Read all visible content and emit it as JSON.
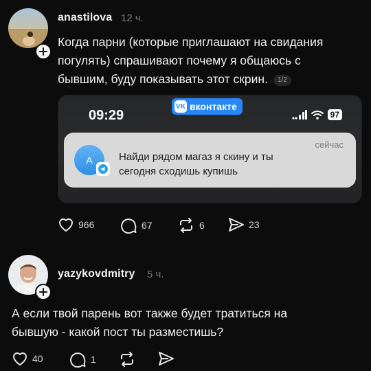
{
  "post1": {
    "username": "anastilova",
    "time": "12 ч.",
    "text_line1": "Когда парни (которые приглашают на свидания",
    "text_line2": "погулять) спрашивают почему я общаюсь с",
    "text_line3": "бывшим, буду показывать этот скрин.",
    "page_indicator": "1/2",
    "screenshot": {
      "clock": "09:29",
      "app_badge": "вконтакте",
      "battery": "97",
      "notification_avatar_letter": "А",
      "notification_time": "сейчас",
      "notification_line1": "Найди рядом магаз я скину и ты",
      "notification_line2": "сегодня сходишь купишь"
    },
    "likes": "966",
    "comments": "67",
    "reposts": "6",
    "shares": "23"
  },
  "post2": {
    "username": "yazykovdmitry",
    "time": "5 ч.",
    "text_line1": "А если твой парень вот также будет тратиться на",
    "text_line2": "бывшую - какой пост ты разместишь?",
    "likes": "40",
    "comments": "1"
  },
  "icons": [
    "plus-icon",
    "heart-icon",
    "comment-icon",
    "repost-icon",
    "share-icon",
    "wifi-icon",
    "signal-icon",
    "telegram-icon"
  ],
  "colors": {
    "background": "#0c0c0c",
    "vk_blue": "#2787f5",
    "secondary_text": "#7a7a7a"
  }
}
